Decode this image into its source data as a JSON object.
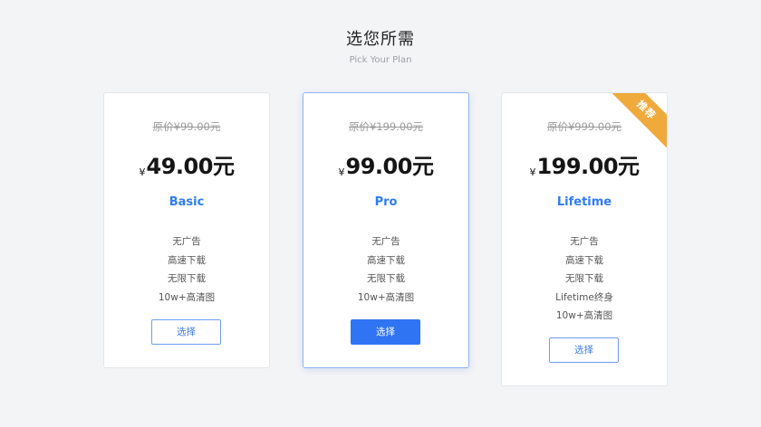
{
  "header": {
    "title": "选您所需",
    "subtitle": "Pick Your Plan"
  },
  "plans": [
    {
      "original_price": "原价¥99.00元",
      "currency": "¥",
      "price": "49.00元",
      "name": "Basic",
      "features": [
        "无广告",
        "高速下载",
        "无限下载",
        "10w+高清图"
      ],
      "button_label": "选择"
    },
    {
      "original_price": "原价¥199.00元",
      "currency": "¥",
      "price": "99.00元",
      "name": "Pro",
      "features": [
        "无广告",
        "高速下载",
        "无限下载",
        "10w+高清图"
      ],
      "button_label": "选择"
    },
    {
      "original_price": "原价¥999.00元",
      "currency": "¥",
      "price": "199.00元",
      "name": "Lifetime",
      "features": [
        "无广告",
        "高速下载",
        "无限下载",
        "Lifetime终身",
        "10w+高清图"
      ],
      "button_label": "选择",
      "badge": "推荐"
    }
  ],
  "colors": {
    "accent": "#2f74f3",
    "badge": "#f0a93b",
    "background": "#f3f4f6"
  }
}
